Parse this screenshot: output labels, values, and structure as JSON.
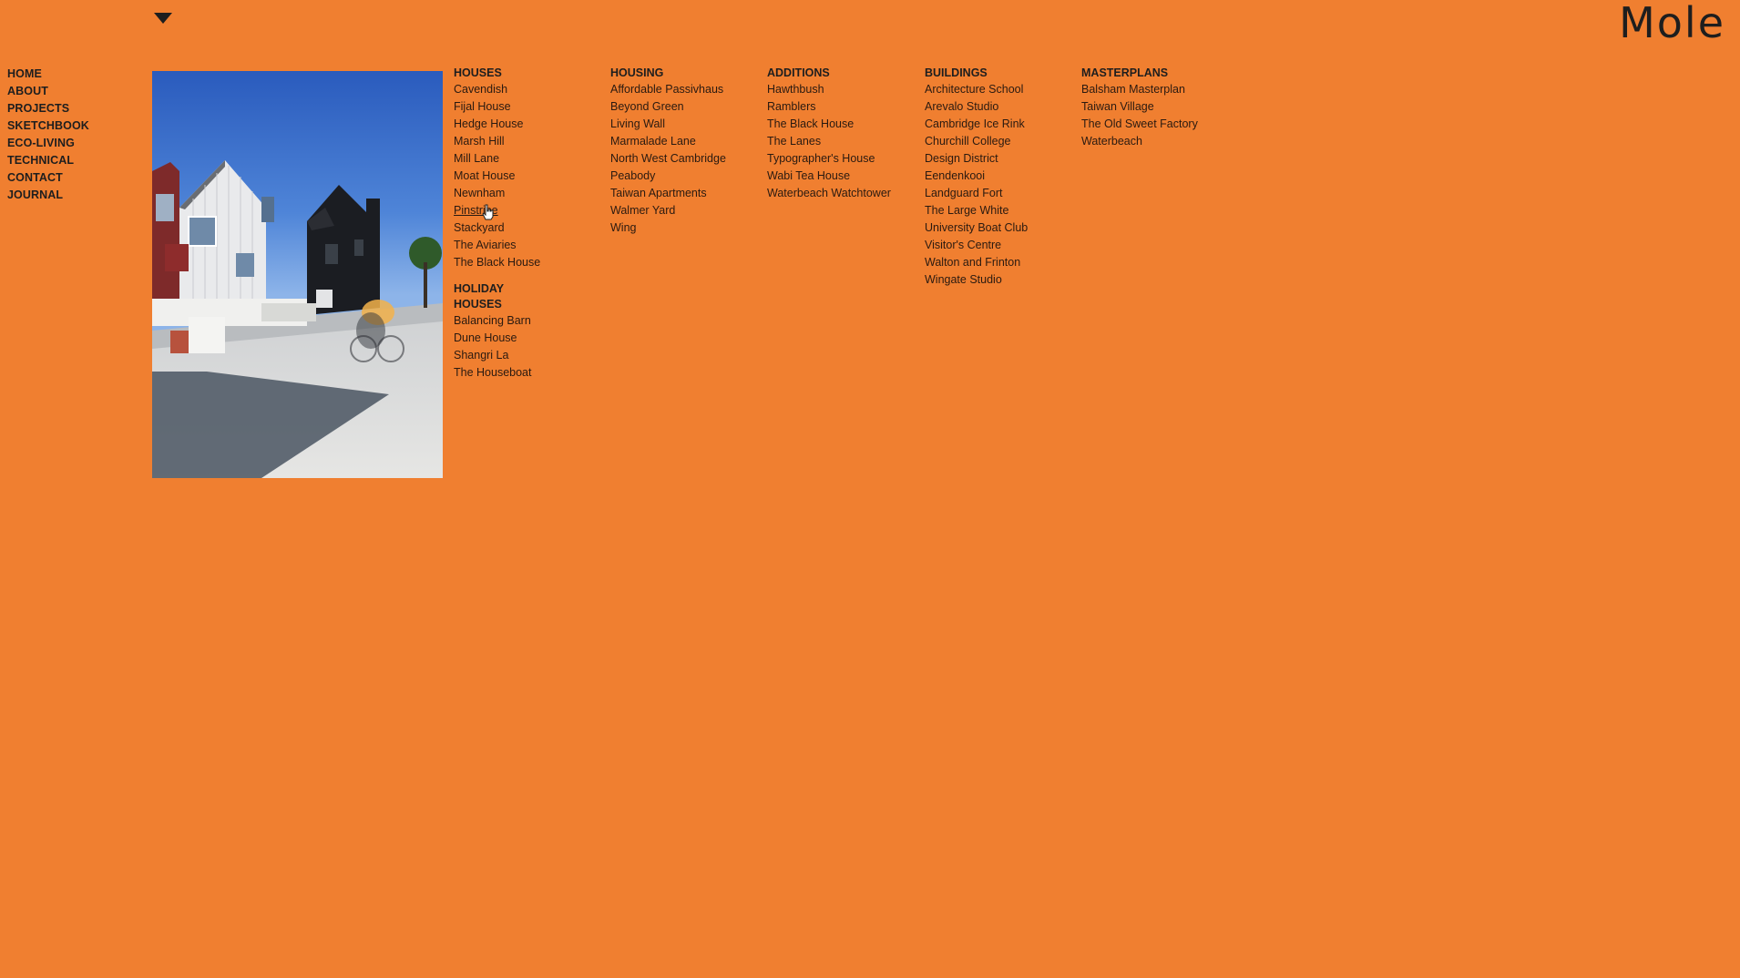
{
  "brand": {
    "logo_text": "Mole",
    "background_color": "#F07F30"
  },
  "menu_toggle": {
    "icon": "triangle-down-icon"
  },
  "main_nav": [
    {
      "label": "HOME"
    },
    {
      "label": "ABOUT"
    },
    {
      "label": "PROJECTS"
    },
    {
      "label": "SKETCHBOOK"
    },
    {
      "label": "ECO-LIVING"
    },
    {
      "label": "TECHNICAL"
    },
    {
      "label": "CONTACT"
    },
    {
      "label": "JOURNAL"
    }
  ],
  "project_menu": {
    "houses": {
      "heading": "HOUSES",
      "items": [
        "Cavendish",
        "Fijal House",
        "Hedge House",
        "Marsh Hill",
        "Mill Lane",
        "Moat House",
        "Newnham",
        "Pinstripe",
        "Stackyard",
        "The Aviaries",
        "The Black House"
      ],
      "hovered_item": "Pinstripe"
    },
    "holiday_houses": {
      "heading": "HOLIDAY HOUSES",
      "items": [
        "Balancing Barn",
        "Dune House",
        "Shangri La",
        "The Houseboat"
      ]
    },
    "housing": {
      "heading": "HOUSING",
      "items": [
        "Affordable Passivhaus",
        "Beyond Green",
        "Living Wall",
        "Marmalade Lane",
        "North West Cambridge",
        "Peabody",
        "Taiwan Apartments",
        "Walmer Yard",
        "Wing"
      ]
    },
    "additions": {
      "heading": "ADDITIONS",
      "items": [
        "Hawthbush",
        "Ramblers",
        "The Black House",
        "The Lanes",
        "Typographer's House",
        "Wabi Tea House",
        "Waterbeach Watchtower"
      ]
    },
    "buildings": {
      "heading": "BUILDINGS",
      "items": [
        "Architecture School",
        "Arevalo Studio",
        "Cambridge Ice Rink",
        "Churchill College",
        "Design District",
        "Eendenkooi",
        "Landguard Fort",
        "The Large White",
        "University Boat Club",
        "Visitor's Centre",
        "Walton and Frinton",
        "Wingate Studio"
      ]
    },
    "masterplans": {
      "heading": "MASTERPLANS",
      "items": [
        "Balsham Masterplan",
        "Taiwan Village",
        "The Old Sweet Factory",
        "Waterbeach"
      ]
    }
  }
}
